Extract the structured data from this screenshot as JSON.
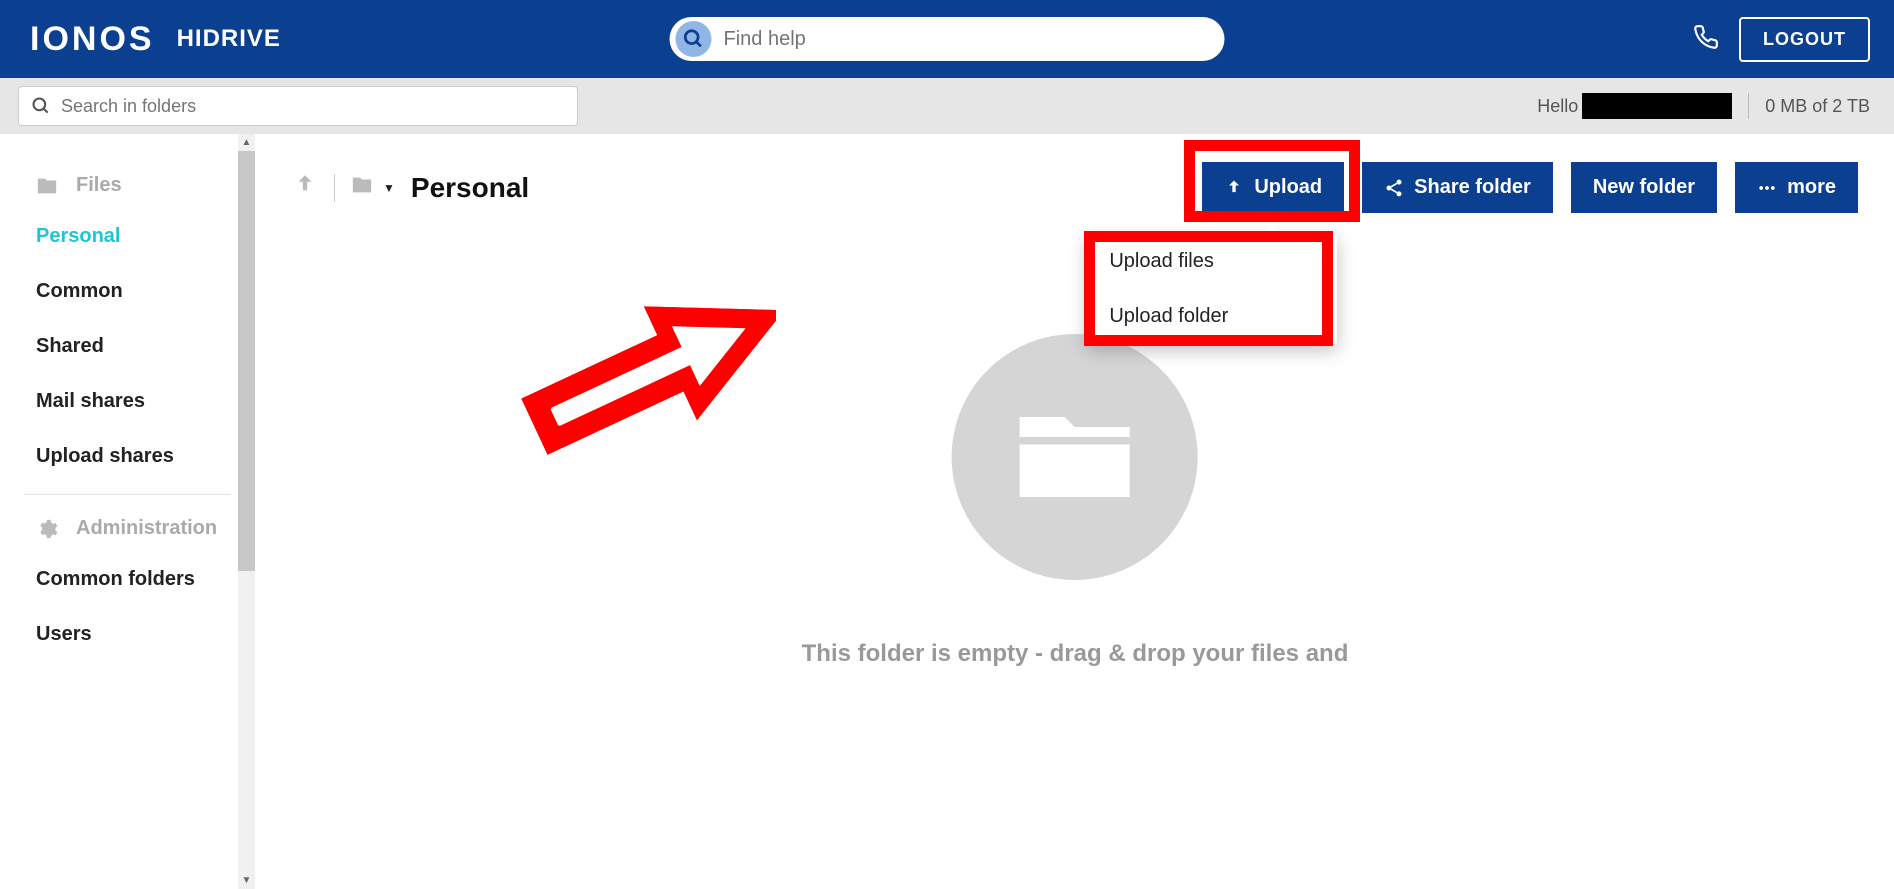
{
  "header": {
    "logo": "IONOS",
    "app_name": "HIDRIVE",
    "search_placeholder": "Find help",
    "logout_label": "LOGOUT"
  },
  "subheader": {
    "folder_search_placeholder": "Search in folders",
    "greeting": "Hello",
    "storage": "0 MB of 2 TB"
  },
  "sidebar": {
    "files_header": "Files",
    "items": [
      {
        "label": "Personal",
        "active": true
      },
      {
        "label": "Common",
        "active": false
      },
      {
        "label": "Shared",
        "active": false
      },
      {
        "label": "Mail shares",
        "active": false
      },
      {
        "label": "Upload shares",
        "active": false
      }
    ],
    "admin_header": "Administration",
    "admin_items": [
      {
        "label": "Common folders"
      },
      {
        "label": "Users"
      }
    ]
  },
  "breadcrumb": {
    "title": "Personal"
  },
  "actions": {
    "upload_label": "Upload",
    "share_label": "Share folder",
    "newfolder_label": "New folder",
    "more_label": "more",
    "dropdown": {
      "upload_files": "Upload files",
      "upload_folder": "Upload folder"
    }
  },
  "empty": {
    "message": "This folder is empty - drag & drop your files and"
  }
}
